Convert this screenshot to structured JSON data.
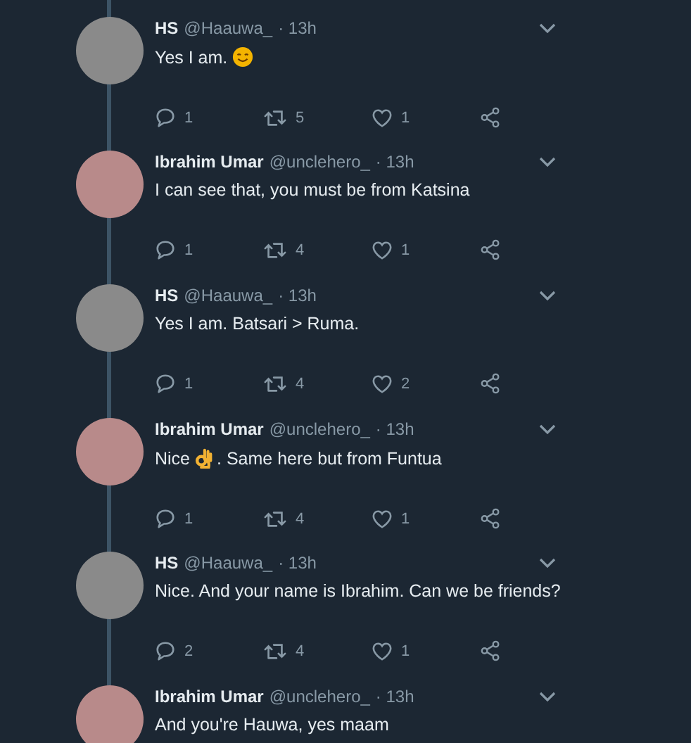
{
  "tweets": [
    {
      "name": "HS",
      "handle": "@Haauwa_",
      "time": "· 13h",
      "color": "#8a8a8a",
      "message": [
        {
          "kind": "text",
          "text": "Yes I am."
        },
        {
          "kind": "smile-emoji"
        }
      ],
      "replies": "1",
      "retweets": "5",
      "likes": "1"
    },
    {
      "name": "Ibrahim Umar",
      "handle": "@unclehero_",
      "time": "· 13h",
      "color": "#b88a8a",
      "message": [
        {
          "kind": "text",
          "text": "I can see that, you must be from Katsina"
        }
      ],
      "replies": "1",
      "retweets": "4",
      "likes": "1"
    },
    {
      "name": "HS",
      "handle": "@Haauwa_",
      "time": "· 13h",
      "color": "#8a8a8a",
      "message": [
        {
          "kind": "text",
          "text": "Yes I am. Batsari > Ruma."
        }
      ],
      "replies": "1",
      "retweets": "4",
      "likes": "2"
    },
    {
      "name": "Ibrahim Umar",
      "handle": "@unclehero_",
      "time": "· 13h",
      "color": "#b88a8a",
      "message": [
        {
          "kind": "text",
          "text": "Nice"
        },
        {
          "kind": "ok-hand-emoji"
        },
        {
          "kind": "text",
          "text": ". Same here but from Funtua"
        }
      ],
      "replies": "1",
      "retweets": "4",
      "likes": "1"
    },
    {
      "name": "HS",
      "handle": "@Haauwa_",
      "time": "· 13h",
      "color": "#8a8a8a",
      "message": [
        {
          "kind": "text",
          "text": "Nice. And your name is Ibrahim. Can we be friends?"
        }
      ],
      "replies": "2",
      "retweets": "4",
      "likes": "1"
    },
    {
      "name": "Ibrahim Umar",
      "handle": "@unclehero_",
      "time": "· 13h",
      "color": "#b88a8a",
      "message": [
        {
          "kind": "text",
          "text": "And you're Hauwa, yes maam"
        }
      ]
    }
  ]
}
